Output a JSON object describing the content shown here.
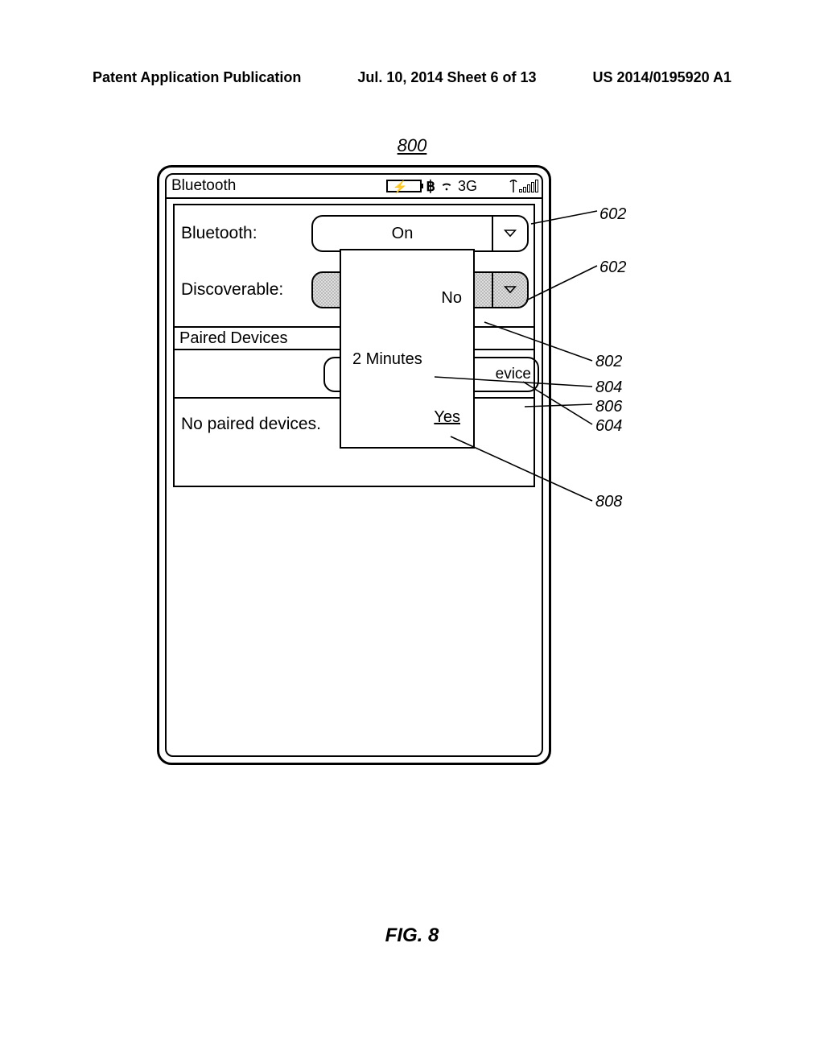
{
  "header": {
    "left": "Patent Application Publication",
    "center": "Jul. 10, 2014  Sheet 6 of 13",
    "right": "US 2014/0195920 A1"
  },
  "figure": {
    "number": "800",
    "caption": "FIG. 8"
  },
  "statusbar": {
    "title": "Bluetooth",
    "network": "3G"
  },
  "settings": {
    "bluetooth_label": "Bluetooth:",
    "bluetooth_value": "On",
    "discoverable_label": "Discoverable:",
    "paired_header": "Paired Devices",
    "add_device_fragment": "evice",
    "no_paired": "No paired devices."
  },
  "dropdown": {
    "opt_no": "No",
    "opt_2min": "2 Minutes",
    "opt_yes": "Yes"
  },
  "callouts": {
    "c602a": "602",
    "c602b": "602",
    "c802": "802",
    "c804": "804",
    "c806": "806",
    "c604": "604",
    "c808": "808"
  }
}
